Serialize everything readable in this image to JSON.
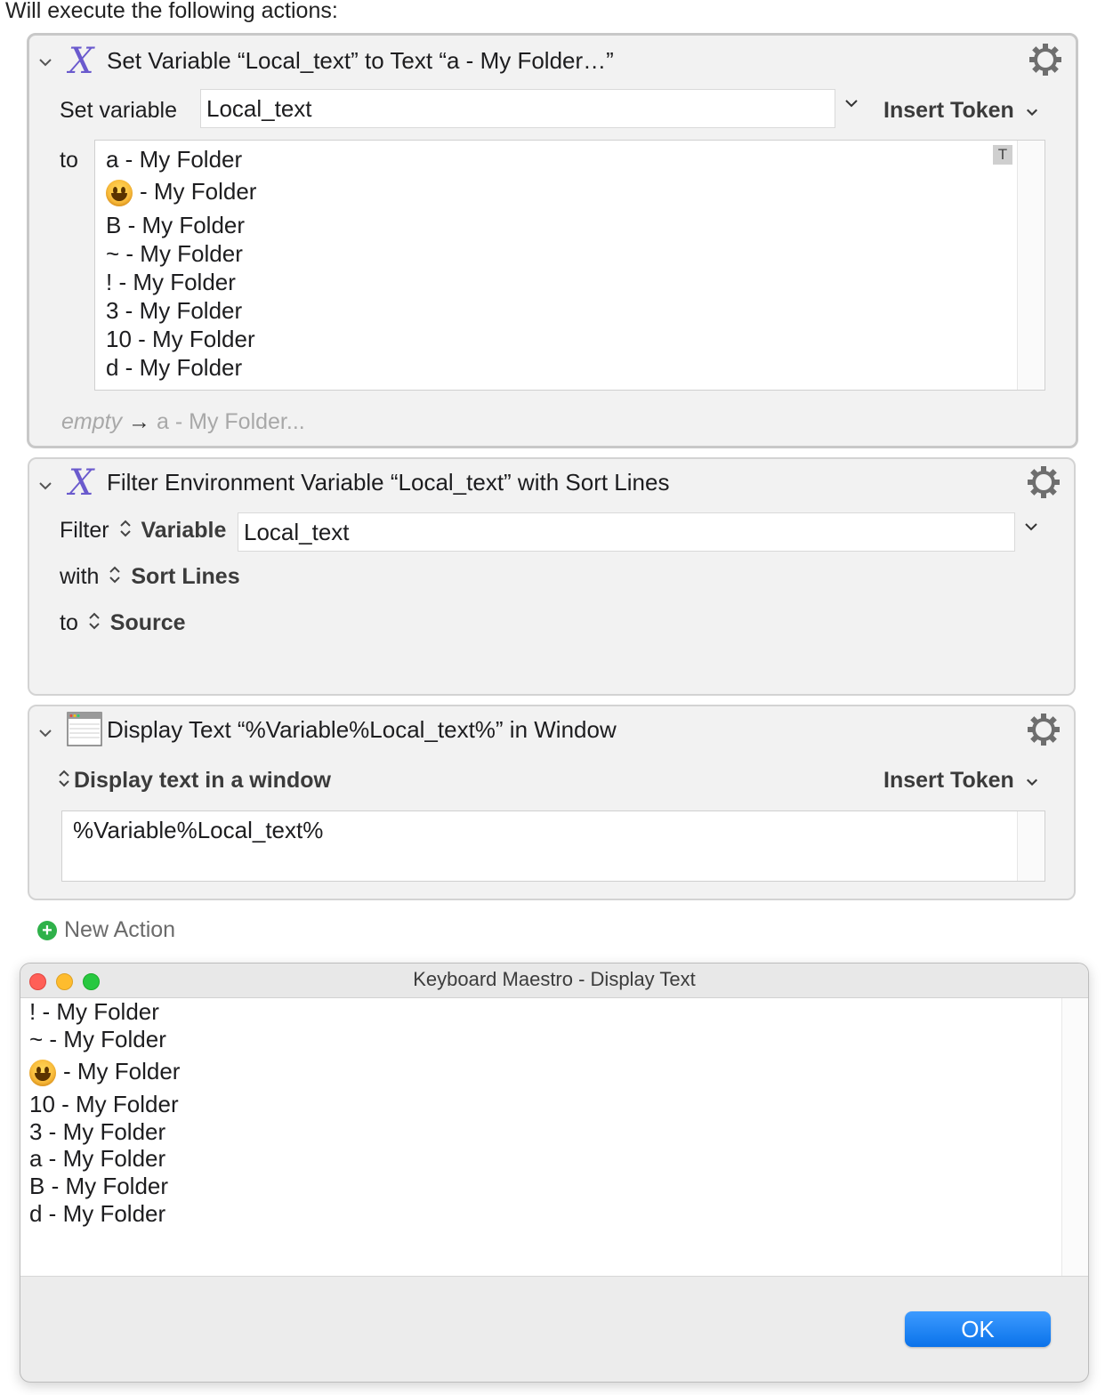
{
  "intro_text": "Will execute the following actions:",
  "actions": [
    {
      "title": "Set Variable “Local_text” to Text “a - My Folder…”",
      "icon": "variable-x-icon",
      "set_variable_label": "Set variable",
      "variable_value": "Local_text",
      "insert_token_label": "Insert Token",
      "to_label": "to",
      "text_badge": "T",
      "text_lines": [
        "a - My Folder",
        "- My Folder",
        "B - My Folder",
        "~ - My Folder",
        "! - My Folder",
        "3 - My Folder",
        "10 - My Folder",
        "d - My Folder"
      ],
      "preview_empty": "empty",
      "preview_arrow": "→",
      "preview_value": "a - My Folder..."
    },
    {
      "title": "Filter Environment Variable “Local_text” with Sort Lines",
      "icon": "variable-x-icon",
      "filter_label": "Filter",
      "filter_type": "Variable",
      "variable_value": "Local_text",
      "with_label": "with",
      "with_value": "Sort Lines",
      "to_label": "to",
      "to_value": "Source"
    },
    {
      "title": "Display Text “%Variable%Local_text%” in Window",
      "icon": "window-icon",
      "display_mode": "Display text in a window",
      "insert_token_label": "Insert Token",
      "text_value": "%Variable%Local_text%"
    }
  ],
  "new_action_label": "New Action",
  "window": {
    "title": "Keyboard Maestro - Display Text",
    "lines": [
      "! - My Folder",
      "~ - My Folder",
      "- My Folder",
      "10 - My Folder",
      "3 - My Folder",
      "a - My Folder",
      "B - My Folder",
      "d - My Folder"
    ],
    "ok_label": "OK"
  },
  "colors": {
    "accent": "#0a72ea",
    "variable_icon": "#6a5acd",
    "close": "#ff5f57",
    "minimize": "#febc2e",
    "zoom": "#28c840",
    "add": "#2fb14a"
  }
}
